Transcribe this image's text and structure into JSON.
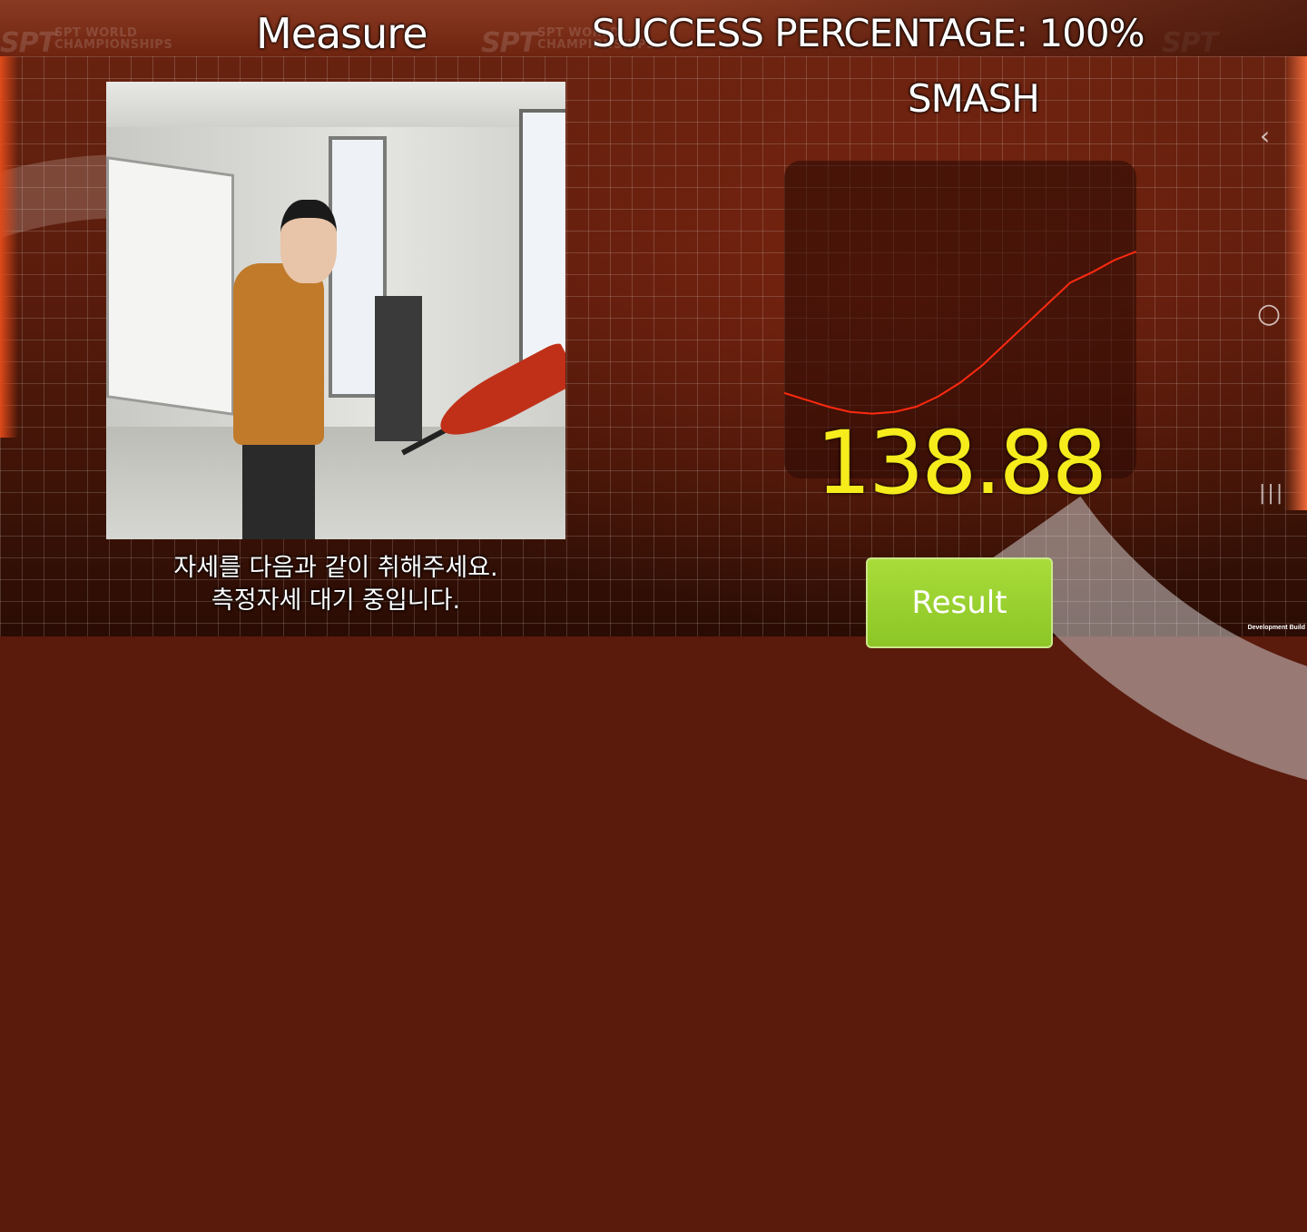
{
  "header": {
    "title": "Measure",
    "success_label": "SUCCESS PERCENTAGE: 100%",
    "mode": "SMASH"
  },
  "camera": {
    "instruction_line1": "자세를 다음과 같이 취해주세요.",
    "instruction_line2": "측정자세 대기 중입니다."
  },
  "chart_data": {
    "type": "line",
    "title": "",
    "xlabel": "",
    "ylabel": "",
    "series": [
      {
        "values": [
          0.18,
          0.14,
          0.1,
          0.07,
          0.06,
          0.07,
          0.1,
          0.16,
          0.24,
          0.34,
          0.46,
          0.58,
          0.7,
          0.82,
          0.88,
          0.95,
          1.0
        ]
      }
    ],
    "ylim": [
      0,
      1
    ],
    "grid": false,
    "line_color": "#ff2a10"
  },
  "result": {
    "value": "138.88",
    "value_color": "#f6ec1c"
  },
  "buttons": {
    "result_label": "Result"
  },
  "watermark": {
    "brand": "SPT",
    "line1": "SPT WORLD",
    "line2": "CHAMPIONSHIPS"
  },
  "system_nav": {
    "back_glyph": "‹",
    "home_glyph": "○",
    "recents_glyph": "|||"
  },
  "dev_build_label": "Development Build"
}
